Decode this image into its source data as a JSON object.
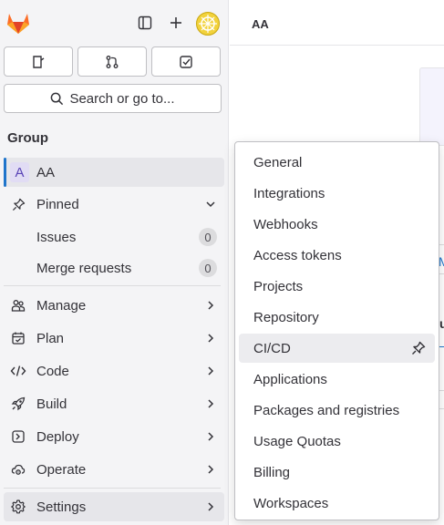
{
  "top_bar": {
    "icons": [
      "gitlab-logo",
      "sidebar-toggle-icon",
      "plus-icon",
      "user-avatar"
    ],
    "quick_actions": [
      "issues-icon",
      "merge-requests-icon",
      "todo-icon"
    ]
  },
  "search": {
    "label": "Search or go to..."
  },
  "sidebar": {
    "section_title": "Group",
    "group": {
      "initial": "A",
      "name": "AA"
    },
    "pinned": {
      "label": "Pinned",
      "items": [
        {
          "label": "Issues",
          "count": "0"
        },
        {
          "label": "Merge requests",
          "count": "0"
        }
      ]
    },
    "items": [
      {
        "label": "Manage",
        "icon": "users-icon"
      },
      {
        "label": "Plan",
        "icon": "calendar-icon"
      },
      {
        "label": "Code",
        "icon": "code-icon"
      },
      {
        "label": "Build",
        "icon": "rocket-icon"
      },
      {
        "label": "Deploy",
        "icon": "deploy-icon"
      },
      {
        "label": "Operate",
        "icon": "cloud-gear-icon"
      },
      {
        "label": "Settings",
        "icon": "gear-icon"
      }
    ]
  },
  "main": {
    "breadcrumb": "AA",
    "background_fragments": [
      "M",
      "u"
    ]
  },
  "settings_flyout": {
    "items": [
      {
        "label": "General"
      },
      {
        "label": "Integrations"
      },
      {
        "label": "Webhooks"
      },
      {
        "label": "Access tokens"
      },
      {
        "label": "Projects"
      },
      {
        "label": "Repository"
      },
      {
        "label": "CI/CD"
      },
      {
        "label": "Applications"
      },
      {
        "label": "Packages and registries"
      },
      {
        "label": "Usage Quotas"
      },
      {
        "label": "Billing"
      },
      {
        "label": "Workspaces"
      }
    ]
  },
  "colors": {
    "sidebar_bg": "#f4f4f6",
    "active_indicator": "#1f75cb",
    "group_avatar_bg": "#e1dcf4",
    "group_avatar_text": "#5943b6",
    "hover_bg": "#ececef"
  }
}
